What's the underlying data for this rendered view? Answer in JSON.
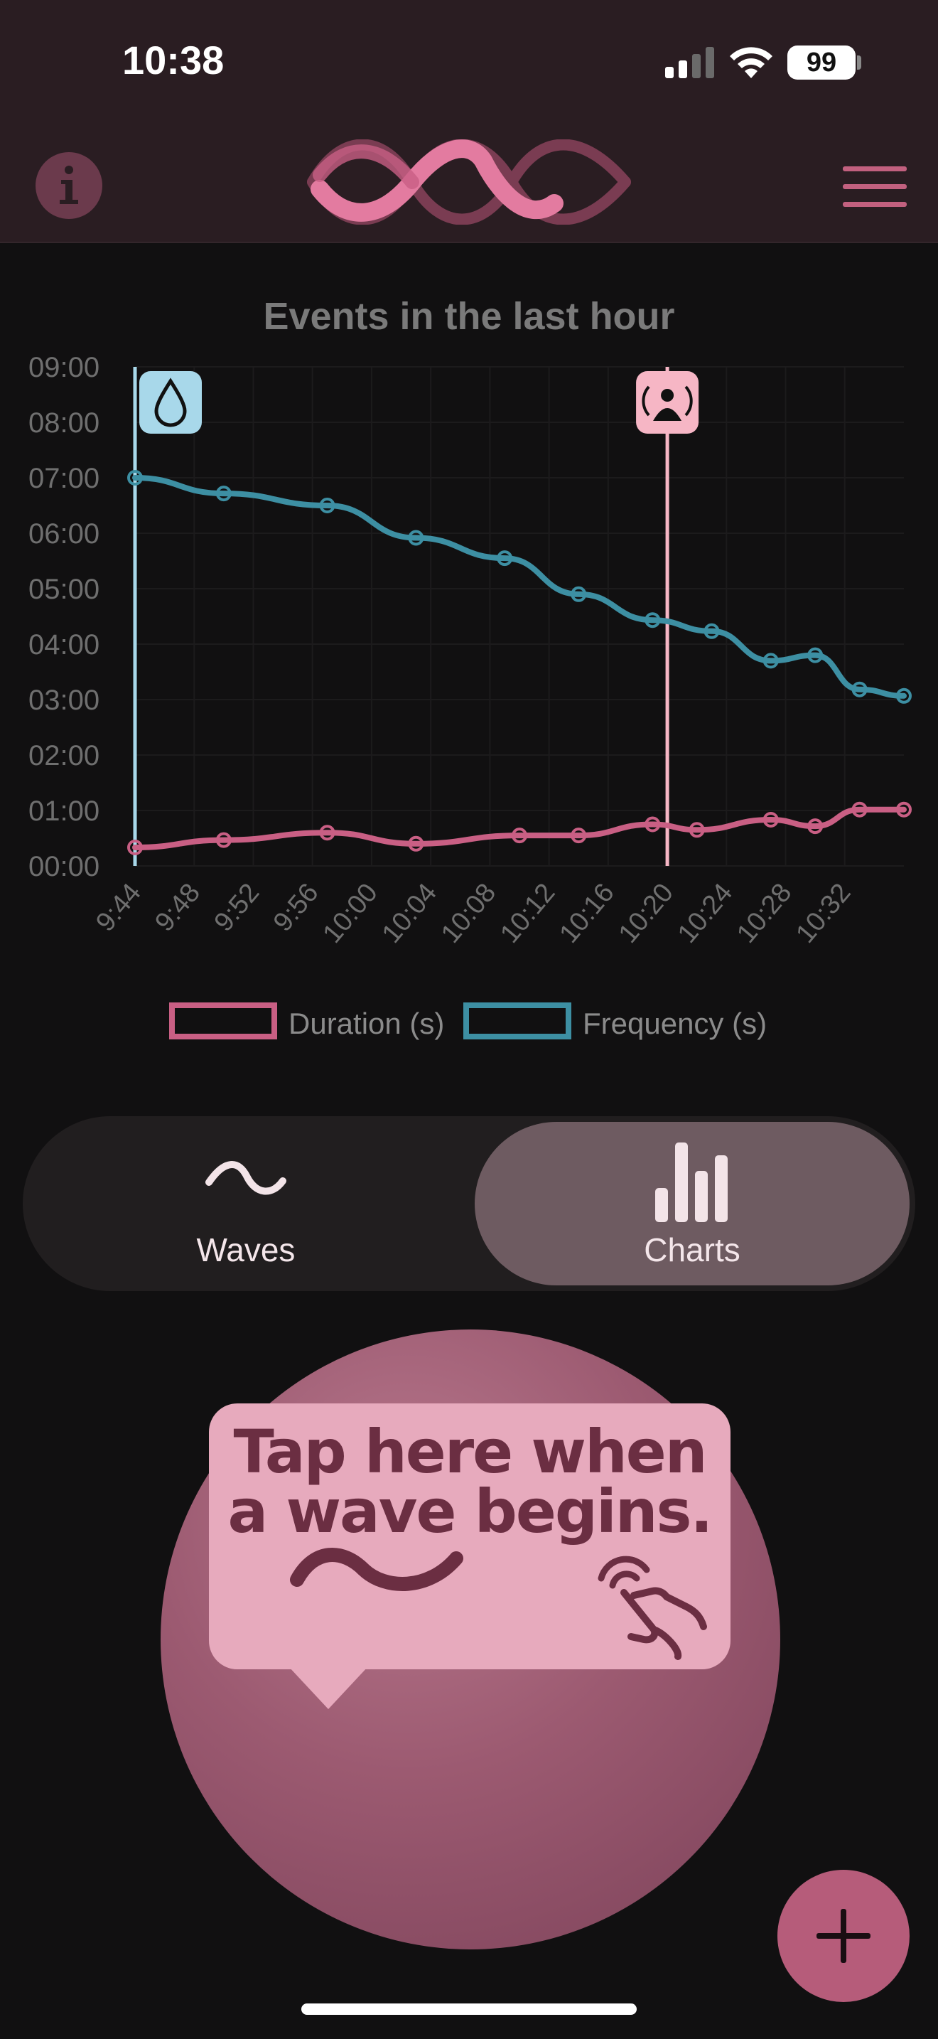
{
  "status": {
    "time": "10:38",
    "battery": "99"
  },
  "header": {
    "info_icon": "info-icon",
    "logo": "wave-logo",
    "menu_icon": "hamburger-icon"
  },
  "chart_data": {
    "type": "line",
    "title": "Events in the last hour",
    "x_ticks": [
      "9:44",
      "9:48",
      "9:52",
      "9:56",
      "10:00",
      "10:04",
      "10:08",
      "10:12",
      "10:16",
      "10:20",
      "10:24",
      "10:28",
      "10:32"
    ],
    "y_ticks": [
      "00:00",
      "01:00",
      "02:00",
      "03:00",
      "04:00",
      "05:00",
      "06:00",
      "07:00",
      "08:00",
      "09:00"
    ],
    "ylim": [
      0,
      540
    ],
    "xlim_minutes": [
      "9:44",
      "10:36"
    ],
    "grid": true,
    "series": [
      {
        "name": "Duration (s)",
        "color": "#c95f84",
        "x": [
          "9:44",
          "9:50",
          "9:57",
          "10:03",
          "10:10",
          "10:14",
          "10:19",
          "10:22",
          "10:27",
          "10:30",
          "10:33",
          "10:36"
        ],
        "y": [
          20,
          28,
          36,
          24,
          33,
          33,
          45,
          39,
          50,
          43,
          61,
          61
        ]
      },
      {
        "name": "Frequency (s)",
        "color": "#3d8fa3",
        "x": [
          "9:44",
          "9:50",
          "9:57",
          "10:03",
          "10:09",
          "10:14",
          "10:19",
          "10:23",
          "10:27",
          "10:30",
          "10:33",
          "10:36"
        ],
        "y": [
          420,
          403,
          390,
          355,
          333,
          294,
          266,
          254,
          222,
          228,
          191,
          184
        ]
      }
    ],
    "markers": [
      {
        "x": "9:44",
        "icon": "water-drop-icon",
        "color": "#a8d8ea"
      },
      {
        "x": "10:20",
        "icon": "contraction-icon",
        "color": "#f6b6c5"
      }
    ],
    "legend_position": "bottom"
  },
  "tabs": [
    {
      "label": "Waves",
      "icon": "wave-icon",
      "selected": false
    },
    {
      "label": "Charts",
      "icon": "bar-chart-icon",
      "selected": true
    }
  ],
  "tap_prompt": {
    "line1": "Tap here when",
    "line2": "a wave begins."
  },
  "fab_icon": "plus-icon"
}
